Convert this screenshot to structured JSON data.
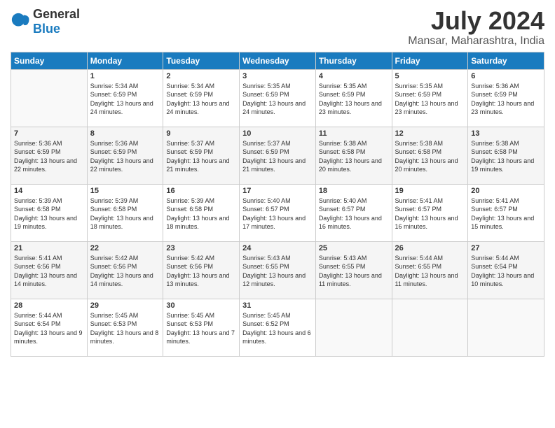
{
  "header": {
    "logo_general": "General",
    "logo_blue": "Blue",
    "title": "July 2024",
    "location": "Mansar, Maharashtra, India"
  },
  "days_of_week": [
    "Sunday",
    "Monday",
    "Tuesday",
    "Wednesday",
    "Thursday",
    "Friday",
    "Saturday"
  ],
  "weeks": [
    [
      {
        "day": "",
        "sunrise": "",
        "sunset": "",
        "daylight": ""
      },
      {
        "day": "1",
        "sunrise": "Sunrise: 5:34 AM",
        "sunset": "Sunset: 6:59 PM",
        "daylight": "Daylight: 13 hours and 24 minutes."
      },
      {
        "day": "2",
        "sunrise": "Sunrise: 5:34 AM",
        "sunset": "Sunset: 6:59 PM",
        "daylight": "Daylight: 13 hours and 24 minutes."
      },
      {
        "day": "3",
        "sunrise": "Sunrise: 5:35 AM",
        "sunset": "Sunset: 6:59 PM",
        "daylight": "Daylight: 13 hours and 24 minutes."
      },
      {
        "day": "4",
        "sunrise": "Sunrise: 5:35 AM",
        "sunset": "Sunset: 6:59 PM",
        "daylight": "Daylight: 13 hours and 23 minutes."
      },
      {
        "day": "5",
        "sunrise": "Sunrise: 5:35 AM",
        "sunset": "Sunset: 6:59 PM",
        "daylight": "Daylight: 13 hours and 23 minutes."
      },
      {
        "day": "6",
        "sunrise": "Sunrise: 5:36 AM",
        "sunset": "Sunset: 6:59 PM",
        "daylight": "Daylight: 13 hours and 23 minutes."
      }
    ],
    [
      {
        "day": "7",
        "sunrise": "Sunrise: 5:36 AM",
        "sunset": "Sunset: 6:59 PM",
        "daylight": "Daylight: 13 hours and 22 minutes."
      },
      {
        "day": "8",
        "sunrise": "Sunrise: 5:36 AM",
        "sunset": "Sunset: 6:59 PM",
        "daylight": "Daylight: 13 hours and 22 minutes."
      },
      {
        "day": "9",
        "sunrise": "Sunrise: 5:37 AM",
        "sunset": "Sunset: 6:59 PM",
        "daylight": "Daylight: 13 hours and 21 minutes."
      },
      {
        "day": "10",
        "sunrise": "Sunrise: 5:37 AM",
        "sunset": "Sunset: 6:59 PM",
        "daylight": "Daylight: 13 hours and 21 minutes."
      },
      {
        "day": "11",
        "sunrise": "Sunrise: 5:38 AM",
        "sunset": "Sunset: 6:58 PM",
        "daylight": "Daylight: 13 hours and 20 minutes."
      },
      {
        "day": "12",
        "sunrise": "Sunrise: 5:38 AM",
        "sunset": "Sunset: 6:58 PM",
        "daylight": "Daylight: 13 hours and 20 minutes."
      },
      {
        "day": "13",
        "sunrise": "Sunrise: 5:38 AM",
        "sunset": "Sunset: 6:58 PM",
        "daylight": "Daylight: 13 hours and 19 minutes."
      }
    ],
    [
      {
        "day": "14",
        "sunrise": "Sunrise: 5:39 AM",
        "sunset": "Sunset: 6:58 PM",
        "daylight": "Daylight: 13 hours and 19 minutes."
      },
      {
        "day": "15",
        "sunrise": "Sunrise: 5:39 AM",
        "sunset": "Sunset: 6:58 PM",
        "daylight": "Daylight: 13 hours and 18 minutes."
      },
      {
        "day": "16",
        "sunrise": "Sunrise: 5:39 AM",
        "sunset": "Sunset: 6:58 PM",
        "daylight": "Daylight: 13 hours and 18 minutes."
      },
      {
        "day": "17",
        "sunrise": "Sunrise: 5:40 AM",
        "sunset": "Sunset: 6:57 PM",
        "daylight": "Daylight: 13 hours and 17 minutes."
      },
      {
        "day": "18",
        "sunrise": "Sunrise: 5:40 AM",
        "sunset": "Sunset: 6:57 PM",
        "daylight": "Daylight: 13 hours and 16 minutes."
      },
      {
        "day": "19",
        "sunrise": "Sunrise: 5:41 AM",
        "sunset": "Sunset: 6:57 PM",
        "daylight": "Daylight: 13 hours and 16 minutes."
      },
      {
        "day": "20",
        "sunrise": "Sunrise: 5:41 AM",
        "sunset": "Sunset: 6:57 PM",
        "daylight": "Daylight: 13 hours and 15 minutes."
      }
    ],
    [
      {
        "day": "21",
        "sunrise": "Sunrise: 5:41 AM",
        "sunset": "Sunset: 6:56 PM",
        "daylight": "Daylight: 13 hours and 14 minutes."
      },
      {
        "day": "22",
        "sunrise": "Sunrise: 5:42 AM",
        "sunset": "Sunset: 6:56 PM",
        "daylight": "Daylight: 13 hours and 14 minutes."
      },
      {
        "day": "23",
        "sunrise": "Sunrise: 5:42 AM",
        "sunset": "Sunset: 6:56 PM",
        "daylight": "Daylight: 13 hours and 13 minutes."
      },
      {
        "day": "24",
        "sunrise": "Sunrise: 5:43 AM",
        "sunset": "Sunset: 6:55 PM",
        "daylight": "Daylight: 13 hours and 12 minutes."
      },
      {
        "day": "25",
        "sunrise": "Sunrise: 5:43 AM",
        "sunset": "Sunset: 6:55 PM",
        "daylight": "Daylight: 13 hours and 11 minutes."
      },
      {
        "day": "26",
        "sunrise": "Sunrise: 5:44 AM",
        "sunset": "Sunset: 6:55 PM",
        "daylight": "Daylight: 13 hours and 11 minutes."
      },
      {
        "day": "27",
        "sunrise": "Sunrise: 5:44 AM",
        "sunset": "Sunset: 6:54 PM",
        "daylight": "Daylight: 13 hours and 10 minutes."
      }
    ],
    [
      {
        "day": "28",
        "sunrise": "Sunrise: 5:44 AM",
        "sunset": "Sunset: 6:54 PM",
        "daylight": "Daylight: 13 hours and 9 minutes."
      },
      {
        "day": "29",
        "sunrise": "Sunrise: 5:45 AM",
        "sunset": "Sunset: 6:53 PM",
        "daylight": "Daylight: 13 hours and 8 minutes."
      },
      {
        "day": "30",
        "sunrise": "Sunrise: 5:45 AM",
        "sunset": "Sunset: 6:53 PM",
        "daylight": "Daylight: 13 hours and 7 minutes."
      },
      {
        "day": "31",
        "sunrise": "Sunrise: 5:45 AM",
        "sunset": "Sunset: 6:52 PM",
        "daylight": "Daylight: 13 hours and 6 minutes."
      },
      {
        "day": "",
        "sunrise": "",
        "sunset": "",
        "daylight": ""
      },
      {
        "day": "",
        "sunrise": "",
        "sunset": "",
        "daylight": ""
      },
      {
        "day": "",
        "sunrise": "",
        "sunset": "",
        "daylight": ""
      }
    ]
  ]
}
